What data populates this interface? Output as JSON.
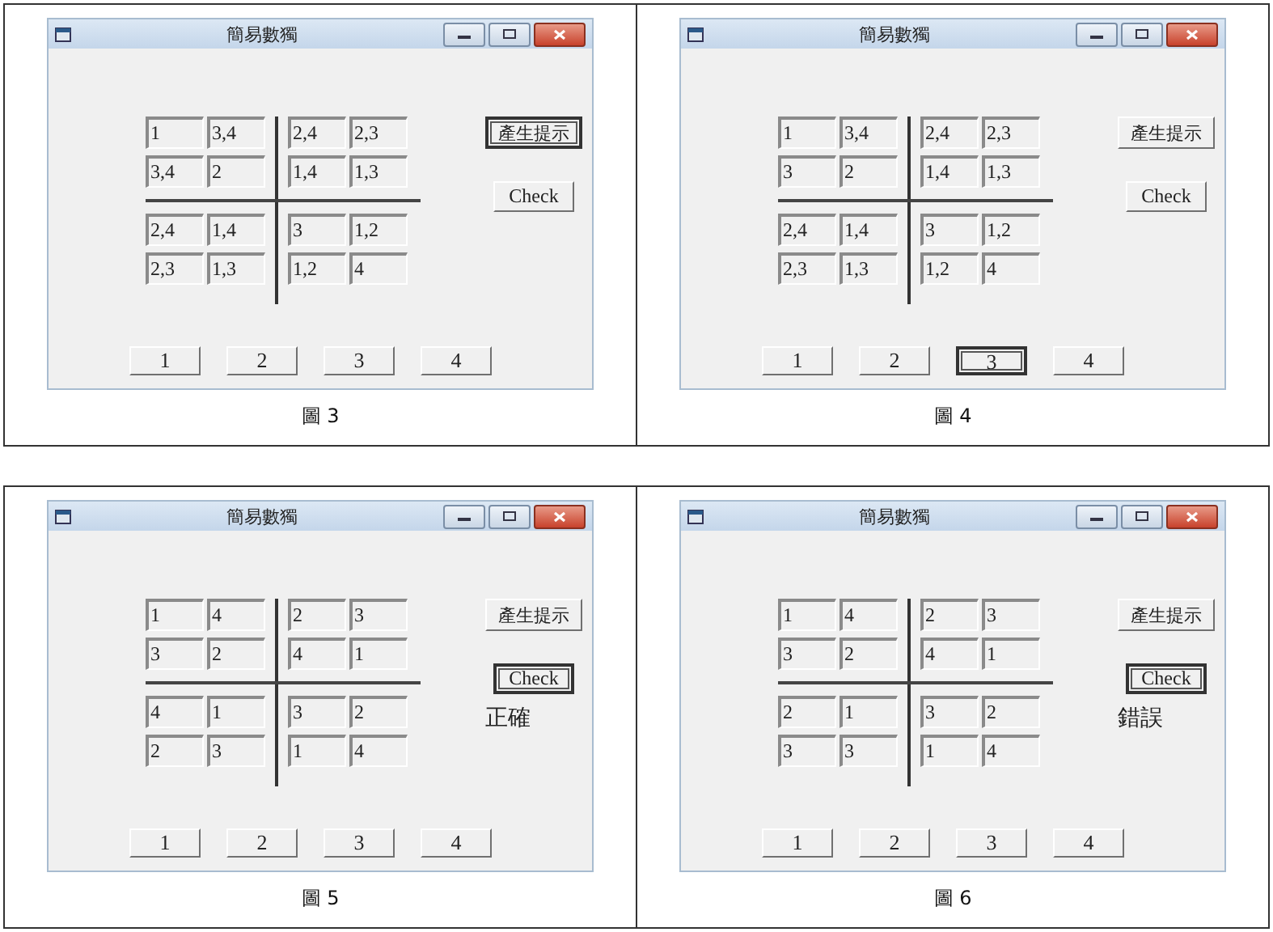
{
  "panels": [
    {
      "caption": "圖 3",
      "window": {
        "title": "簡易數獨"
      },
      "grid": [
        [
          "1",
          "3,4",
          "2,4",
          "2,3"
        ],
        [
          "3,4",
          "2",
          "1,4",
          "1,3"
        ],
        [
          "2,4",
          "1,4",
          "3",
          "1,2"
        ],
        [
          "2,3",
          "1,3",
          "1,2",
          "4"
        ]
      ],
      "hint_button": {
        "label": "產生提示",
        "focused": true
      },
      "check_button": {
        "label": "Check",
        "focused": false
      },
      "number_buttons": [
        {
          "label": "1",
          "focused": false
        },
        {
          "label": "2",
          "focused": false
        },
        {
          "label": "3",
          "focused": false
        },
        {
          "label": "4",
          "focused": false
        }
      ]
    },
    {
      "caption": "圖 4",
      "window": {
        "title": "簡易數獨"
      },
      "grid": [
        [
          "1",
          "3,4",
          "2,4",
          "2,3"
        ],
        [
          "3",
          "2",
          "1,4",
          "1,3"
        ],
        [
          "2,4",
          "1,4",
          "3",
          "1,2"
        ],
        [
          "2,3",
          "1,3",
          "1,2",
          "4"
        ]
      ],
      "hint_button": {
        "label": "產生提示",
        "focused": false
      },
      "check_button": {
        "label": "Check",
        "focused": false
      },
      "number_buttons": [
        {
          "label": "1",
          "focused": false
        },
        {
          "label": "2",
          "focused": false
        },
        {
          "label": "3",
          "focused": true
        },
        {
          "label": "4",
          "focused": false
        }
      ]
    },
    {
      "caption": "圖 5",
      "window": {
        "title": "簡易數獨"
      },
      "grid": [
        [
          "1",
          "4",
          "2",
          "3"
        ],
        [
          "3",
          "2",
          "4",
          "1"
        ],
        [
          "4",
          "1",
          "3",
          "2"
        ],
        [
          "2",
          "3",
          "1",
          "4"
        ]
      ],
      "hint_button": {
        "label": "產生提示",
        "focused": false
      },
      "check_button": {
        "label": "Check",
        "focused": true
      },
      "result": "正確",
      "number_buttons": [
        {
          "label": "1",
          "focused": false
        },
        {
          "label": "2",
          "focused": false
        },
        {
          "label": "3",
          "focused": false
        },
        {
          "label": "4",
          "focused": false
        }
      ]
    },
    {
      "caption": "圖 6",
      "window": {
        "title": "簡易數獨"
      },
      "grid": [
        [
          "1",
          "4",
          "2",
          "3"
        ],
        [
          "3",
          "2",
          "4",
          "1"
        ],
        [
          "2",
          "1",
          "3",
          "2"
        ],
        [
          "3",
          "3",
          "1",
          "4"
        ]
      ],
      "hint_button": {
        "label": "產生提示",
        "focused": false
      },
      "check_button": {
        "label": "Check",
        "focused": true
      },
      "result": "錯誤",
      "number_buttons": [
        {
          "label": "1",
          "focused": false
        },
        {
          "label": "2",
          "focused": false
        },
        {
          "label": "3",
          "focused": false
        },
        {
          "label": "4",
          "focused": false
        }
      ]
    }
  ]
}
